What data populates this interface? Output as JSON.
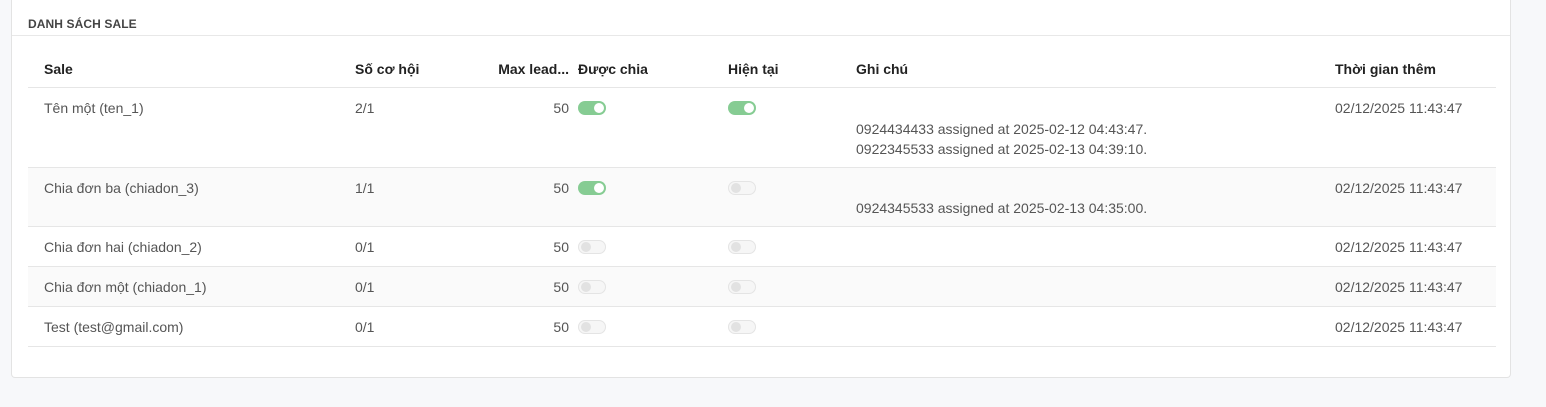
{
  "panel": {
    "title": "DANH SÁCH SALE"
  },
  "table": {
    "columns": {
      "sale": "Sale",
      "so_co_hoi": "Số cơ hội",
      "max_lead": "Max lead...",
      "duoc_chia": "Được chia",
      "hien_tai": "Hiện tại",
      "ghi_chu": "Ghi chú",
      "thoi_gian_them": "Thời gian thêm"
    },
    "rows": [
      {
        "sale": "Tên một (ten_1)",
        "so_co_hoi": "2/1",
        "max_lead": "50",
        "duoc_chia": true,
        "hien_tai": true,
        "notes": [
          "0924434433 assigned at 2025-02-12 04:43:47.",
          "0922345533 assigned at 2025-02-13 04:39:10."
        ],
        "thoi_gian_them": "02/12/2025 11:43:47"
      },
      {
        "sale": "Chia đơn ba (chiadon_3)",
        "so_co_hoi": "1/1",
        "max_lead": "50",
        "duoc_chia": true,
        "hien_tai": false,
        "notes": [
          "0924345533 assigned at 2025-02-13 04:35:00."
        ],
        "thoi_gian_them": "02/12/2025 11:43:47"
      },
      {
        "sale": "Chia đơn hai (chiadon_2)",
        "so_co_hoi": "0/1",
        "max_lead": "50",
        "duoc_chia": false,
        "hien_tai": false,
        "notes": [],
        "thoi_gian_them": "02/12/2025 11:43:47"
      },
      {
        "sale": "Chia đơn một (chiadon_1)",
        "so_co_hoi": "0/1",
        "max_lead": "50",
        "duoc_chia": false,
        "hien_tai": false,
        "notes": [],
        "thoi_gian_them": "02/12/2025 11:43:47"
      },
      {
        "sale": "Test (test@gmail.com)",
        "so_co_hoi": "0/1",
        "max_lead": "50",
        "duoc_chia": false,
        "hien_tai": false,
        "notes": [],
        "thoi_gian_them": "02/12/2025 11:43:47"
      }
    ]
  },
  "colors": {
    "toggle_on": "#86cc93",
    "toggle_off": "#f6f6f6"
  }
}
